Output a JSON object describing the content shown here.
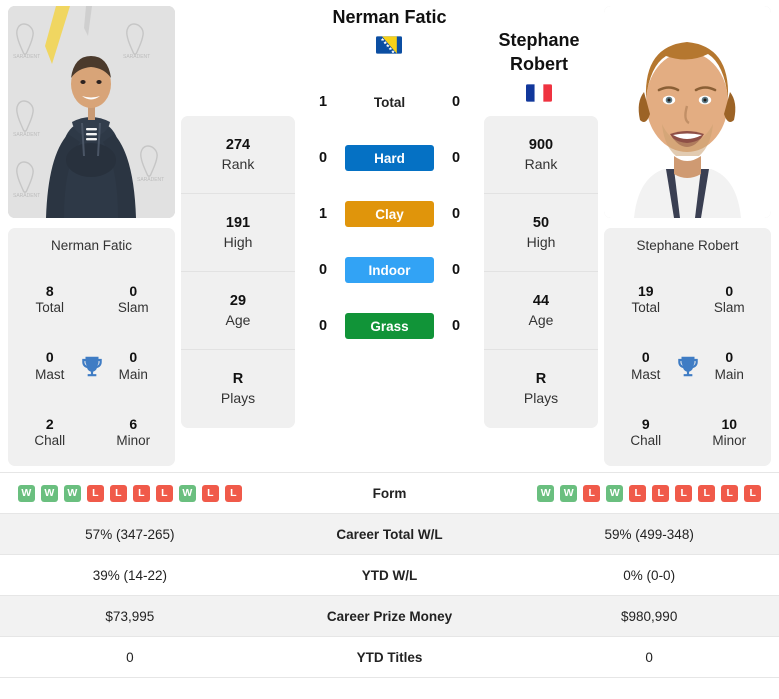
{
  "players": {
    "left": {
      "name": "Nerman Fatic",
      "flag_name": "bosnia-herzegovina-flag",
      "photo_alt": "Nerman Fatic",
      "card_name": "Nerman Fatic",
      "rank": "274",
      "rank_label": "Rank",
      "high": "191",
      "high_label": "High",
      "age": "29",
      "age_label": "Age",
      "plays": "R",
      "plays_label": "Plays",
      "titles": {
        "total": "8",
        "total_label": "Total",
        "slam": "0",
        "slam_label": "Slam",
        "mast": "0",
        "mast_label": "Mast",
        "main": "0",
        "main_label": "Main",
        "chall": "2",
        "chall_label": "Chall",
        "minor": "6",
        "minor_label": "Minor"
      },
      "form": [
        "W",
        "W",
        "W",
        "L",
        "L",
        "L",
        "L",
        "W",
        "L",
        "L"
      ],
      "career_wl": "57% (347-265)",
      "ytd_wl": "39% (14-22)",
      "career_prize": "$73,995",
      "ytd_titles": "0"
    },
    "right": {
      "name": "Stephane Robert",
      "flag_name": "france-flag",
      "photo_alt": "Stephane Robert",
      "card_name": "Stephane Robert",
      "rank": "900",
      "rank_label": "Rank",
      "high": "50",
      "high_label": "High",
      "age": "44",
      "age_label": "Age",
      "plays": "R",
      "plays_label": "Plays",
      "titles": {
        "total": "19",
        "total_label": "Total",
        "slam": "0",
        "slam_label": "Slam",
        "mast": "0",
        "mast_label": "Mast",
        "main": "0",
        "main_label": "Main",
        "chall": "9",
        "chall_label": "Chall",
        "minor": "10",
        "minor_label": "Minor"
      },
      "form": [
        "W",
        "W",
        "L",
        "W",
        "L",
        "L",
        "L",
        "L",
        "L",
        "L"
      ],
      "career_wl": "59% (499-348)",
      "ytd_wl": "0% (0-0)",
      "career_prize": "$980,990",
      "ytd_titles": "0"
    }
  },
  "h2h": {
    "rows": [
      {
        "label": "Total",
        "left": "1",
        "right": "0",
        "type": "total",
        "color": ""
      },
      {
        "label": "Hard",
        "left": "0",
        "right": "0",
        "type": "surface",
        "color": "#0571c4"
      },
      {
        "label": "Clay",
        "left": "1",
        "right": "0",
        "type": "surface",
        "color": "#e0950b"
      },
      {
        "label": "Indoor",
        "left": "0",
        "right": "0",
        "type": "surface",
        "color": "#32a3f5"
      },
      {
        "label": "Grass",
        "left": "0",
        "right": "0",
        "type": "surface",
        "color": "#119438"
      }
    ]
  },
  "table": {
    "rows": [
      {
        "label": "Form",
        "type": "form"
      },
      {
        "label": "Career Total W/L",
        "left": "57% (347-265)",
        "right": "59% (499-348)"
      },
      {
        "label": "YTD W/L",
        "left": "39% (14-22)",
        "right": "0% (0-0)"
      },
      {
        "label": "Career Prize Money",
        "left": "$73,995",
        "right": "$980,990"
      },
      {
        "label": "YTD Titles",
        "left": "0",
        "right": "0"
      }
    ]
  },
  "colors": {
    "win": "#6abf7f",
    "loss": "#f05a4a",
    "hard": "#0571c4",
    "clay": "#e0950b",
    "indoor": "#32a3f5",
    "grass": "#119438",
    "card_bg": "#f0f0f0",
    "trophy": "#3f7cc4"
  }
}
